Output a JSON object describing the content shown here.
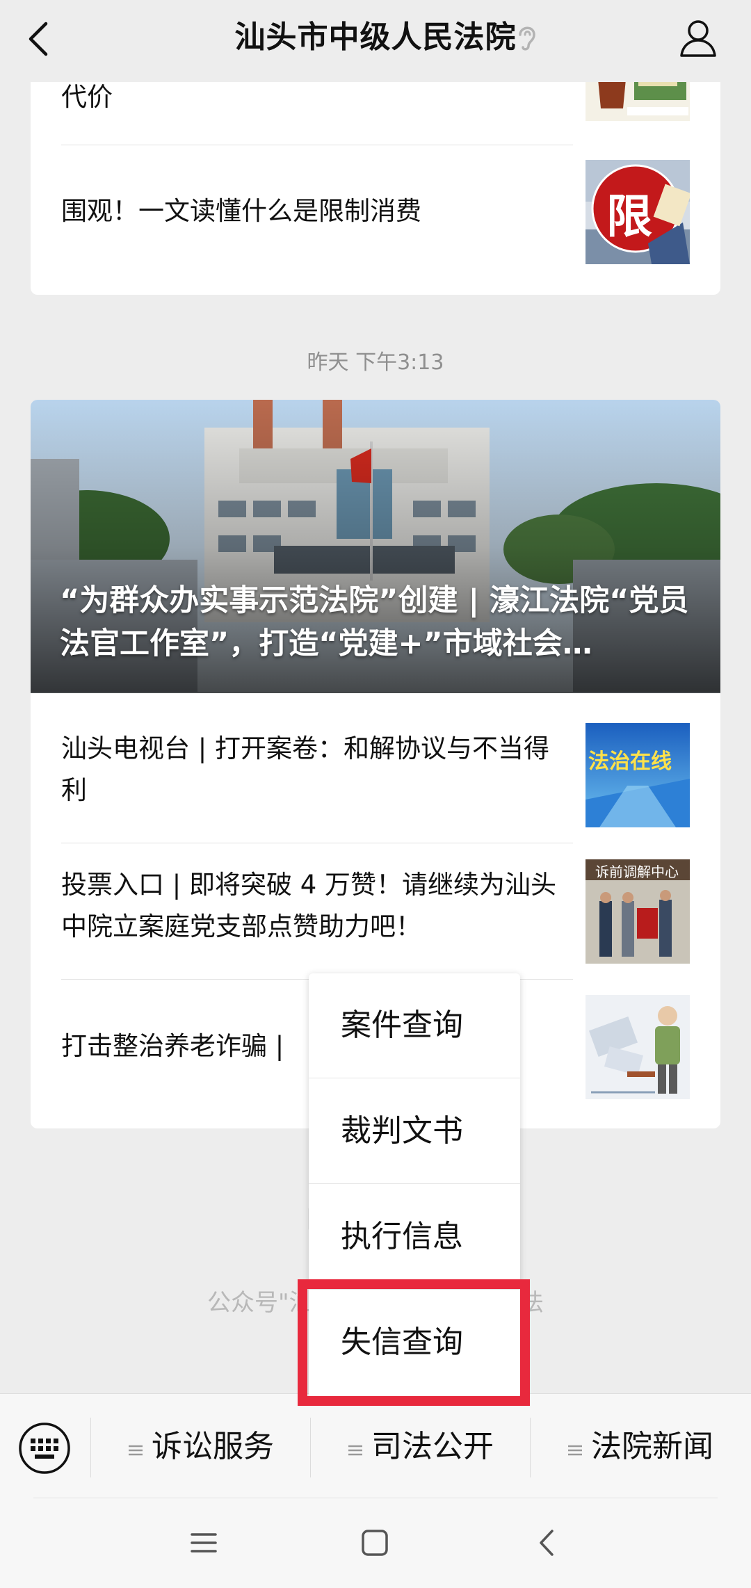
{
  "header": {
    "title": "汕头市中级人民法院"
  },
  "card1": {
    "items": [
      {
        "title": "代价"
      },
      {
        "title": "围观！一文读懂什么是限制消费"
      }
    ],
    "thumb_text": "限"
  },
  "timestamp": "昨天 下午3:13",
  "card2": {
    "cover_title": "“为群众办实事示范法院”创建 | 濠江法院“党员法官工作室”，打造“党建+”市域社会…",
    "items": [
      {
        "title": "汕头电视台 | 打开案卷：和解协议与不当得利",
        "thumb_text": "法治在线"
      },
      {
        "title": "投票入口 | 即将突破 4 万赞！请继续为汕头中院立案庭党支部点赞助力吧！",
        "thumb_text": "诉前调解中心"
      },
      {
        "title": "打击整治养老诈骗 |"
      }
    ]
  },
  "footer": {
    "hint": "|",
    "text": "公众号\"汕头法院\"已                      中级人民法"
  },
  "popup": {
    "items": [
      "案件查询",
      "裁判文书",
      "执行信息",
      "失信查询"
    ],
    "highlight_color": "#e8293d"
  },
  "menubar": {
    "items": [
      "诉讼服务",
      "司法公开",
      "法院新闻"
    ]
  },
  "icons": {
    "back": "chevron-left-icon",
    "ear": "ear-icon",
    "user": "user-icon",
    "keyboard": "keyboard-icon",
    "nav_menu": "menu-icon",
    "nav_home": "square-icon",
    "nav_back": "triangle-back-icon"
  }
}
